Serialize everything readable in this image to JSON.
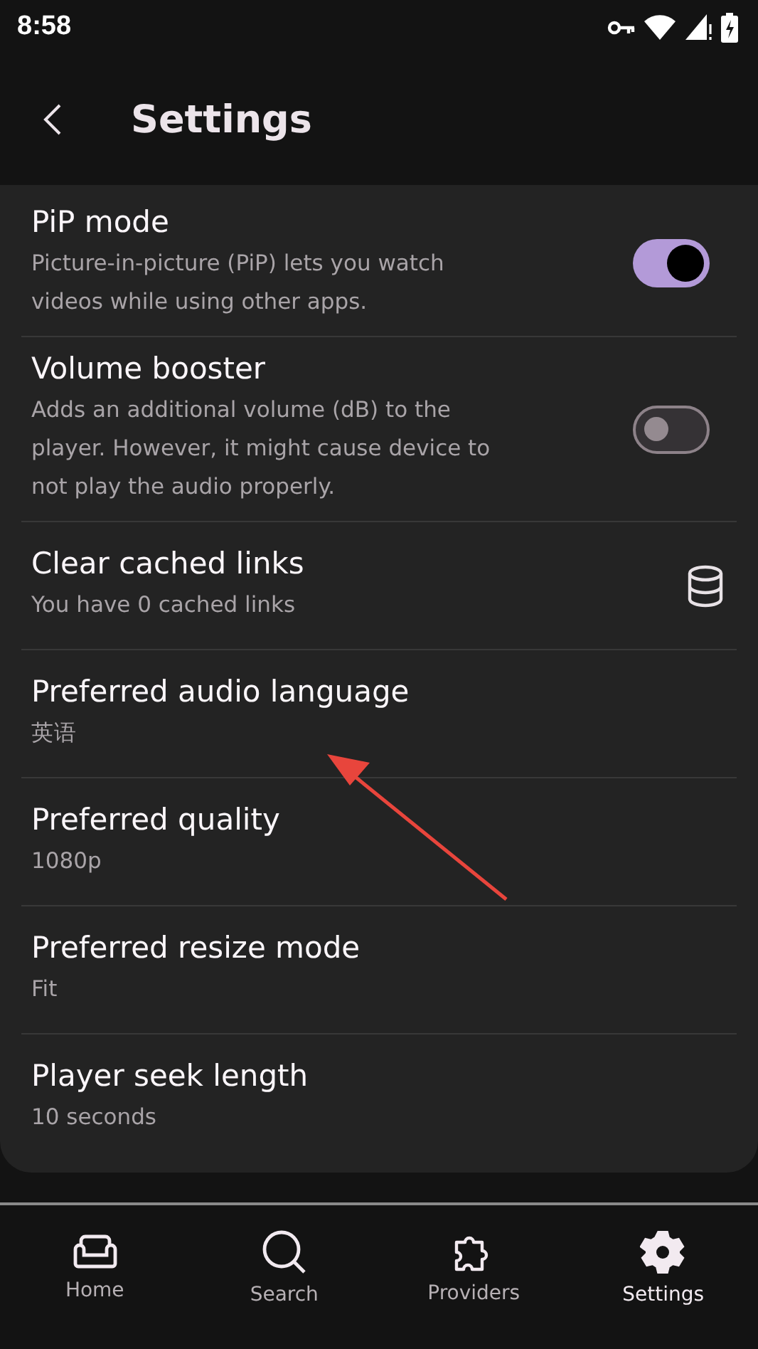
{
  "status_bar": {
    "time": "8:58"
  },
  "app_bar": {
    "title": "Settings"
  },
  "settings": [
    {
      "kind": "toggle",
      "title": "PiP mode",
      "subtitle": "Picture-in-picture (PiP) lets you watch videos while using other apps.",
      "on": true
    },
    {
      "kind": "toggle",
      "title": "Volume booster",
      "subtitle": "Adds an additional volume (dB) to the player. However, it might cause device to not play the audio properly.",
      "on": false
    },
    {
      "kind": "icon",
      "title": "Clear cached links",
      "subtitle": "You have 0 cached links"
    },
    {
      "kind": "plain",
      "title": "Preferred audio language",
      "subtitle": "英语"
    },
    {
      "kind": "plain",
      "title": "Preferred quality",
      "subtitle": "1080p"
    },
    {
      "kind": "plain",
      "title": "Preferred resize mode",
      "subtitle": "Fit"
    },
    {
      "kind": "plain",
      "title": "Player seek length",
      "subtitle": "10 seconds"
    }
  ],
  "nav": [
    {
      "kind": "home",
      "label": "Home",
      "selected": false
    },
    {
      "kind": "search",
      "label": "Search",
      "selected": false
    },
    {
      "kind": "providers",
      "label": "Providers",
      "selected": false
    },
    {
      "kind": "settings",
      "label": "Settings",
      "selected": true
    }
  ]
}
